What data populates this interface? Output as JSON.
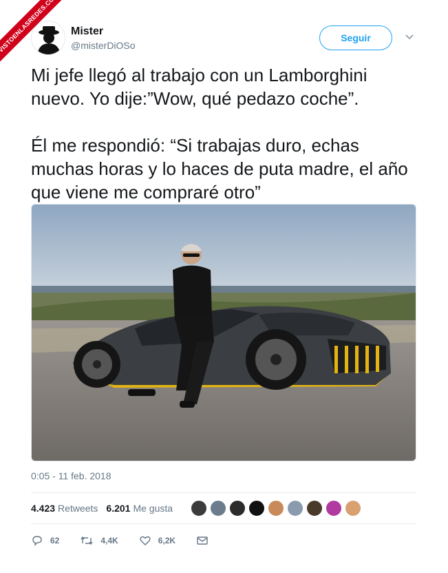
{
  "watermark": "VISTOENLASREDES.COM",
  "tweet": {
    "author_name": "Mister",
    "author_handle": "@misterDiOSo",
    "follow_label": "Seguir",
    "text": "Mi jefe llegó al trabajo con un Lamborghini nuevo. Yo dije:”Wow, qué pedazo coche”.\n\nÉl me respondió: “Si trabajas duro, echas muchas horas y lo haces de puta madre, el año que viene me compraré otro”",
    "timestamp": "0:05 - 11 feb. 2018"
  },
  "stats": {
    "retweets_count": "4.423",
    "retweets_label": "Retweets",
    "likes_count": "6.201",
    "likes_label": "Me gusta",
    "liker_avatar_colors": [
      "#3b3b3b",
      "#6b7d8c",
      "#2c2c2c",
      "#111111",
      "#c98a5b",
      "#8a9bb0",
      "#4a3a2a",
      "#b03aa0",
      "#d9a070"
    ]
  },
  "actions": {
    "reply_count": "62",
    "retweet_count": "4,4K",
    "like_count": "6,2K"
  },
  "colors": {
    "accent": "#1da1f2",
    "muted": "#657786",
    "text": "#14171a"
  }
}
